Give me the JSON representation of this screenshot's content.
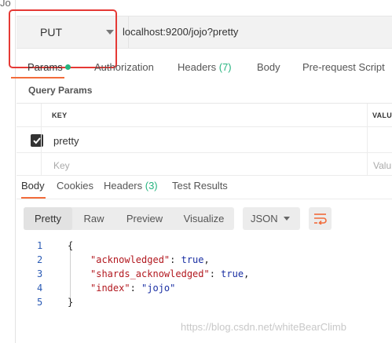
{
  "corner": {
    "text": "Jo"
  },
  "request": {
    "method": "PUT",
    "url": "localhost:9200/jojo?pretty"
  },
  "request_tabs": [
    {
      "label": "Params",
      "count": "",
      "active": true
    },
    {
      "label": "Authorization",
      "count": ""
    },
    {
      "label": "Headers ",
      "count": "(7)"
    },
    {
      "label": "Body",
      "count": ""
    },
    {
      "label": "Pre-request Script",
      "count": ""
    }
  ],
  "query_params": {
    "title": "Query Params",
    "header_key": "KEY",
    "header_value": "VALU",
    "rows": [
      {
        "checked": true,
        "key": "pretty",
        "value": ""
      }
    ],
    "placeholder_key": "Key",
    "placeholder_value": "Valu"
  },
  "response_tabs": [
    {
      "label": "Body",
      "count": "",
      "active": true
    },
    {
      "label": "Cookies",
      "count": ""
    },
    {
      "label": "Headers ",
      "count": "(3)"
    },
    {
      "label": "Test Results",
      "count": ""
    }
  ],
  "body_toolbar": {
    "views": [
      "Pretty",
      "Raw",
      "Preview",
      "Visualize"
    ],
    "active_view": "Pretty",
    "format": "JSON"
  },
  "response_body": {
    "line_numbers": [
      "1",
      "2",
      "3",
      "4",
      "5"
    ],
    "open_brace": "{",
    "close_brace": "}",
    "entries": [
      {
        "key": "\"acknowledged\"",
        "value": "true",
        "trailing": ","
      },
      {
        "key": "\"shards_acknowledged\"",
        "value": "true",
        "trailing": ","
      },
      {
        "key": "\"index\"",
        "value": "\"jojo\"",
        "trailing": ""
      }
    ]
  },
  "watermark": "https://blog.csdn.net/whiteBearClimb",
  "colors": {
    "accent": "#f26b3a",
    "green_count": "#26b47f",
    "highlight_box": "#e53935",
    "json_key": "#b2181f",
    "json_value": "#1a2fa3",
    "line_number": "#2b5bb5"
  },
  "icons": {
    "method_dropdown": "chevron-down-icon",
    "checkbox": "checkmark-icon",
    "format_dropdown": "chevron-down-icon",
    "wrap_lines": "wrap-lines-icon"
  }
}
